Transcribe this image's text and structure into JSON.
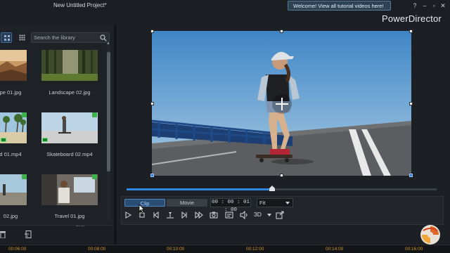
{
  "window": {
    "project_title": "New Untitled Project*",
    "welcome_banner": "Welcome! View all tutorial videos here!",
    "help_label": "?",
    "brand": "PowerDirector",
    "accent_color": "#2f86e0"
  },
  "library": {
    "search_placeholder": "Search the library",
    "items": [
      {
        "label": "pe 01.jpg",
        "icon": "landscape-thumbnail"
      },
      {
        "label": "Landscape 02.jpg",
        "icon": "forest-thumbnail"
      },
      {
        "label": "d 01.mp4",
        "icon": "beach-video-thumbnail",
        "used": true
      },
      {
        "label": "Skateboard 02.mp4",
        "icon": "skateboard-video-thumbnail",
        "used": true
      },
      {
        "label": "02.jpg",
        "icon": "travel-thumbnail",
        "used": true
      },
      {
        "label": "Travel 01.jpg",
        "icon": "travel-photo-thumbnail",
        "used": true
      }
    ]
  },
  "preview": {
    "tabs": [
      "Clip",
      "Movie"
    ],
    "active_tab": "Clip",
    "timecode": "00 : 00 : 01 : 00",
    "zoom": "Fit",
    "seek_progress": 0.47,
    "mode_3d": "3D"
  },
  "timeline": {
    "ticks": [
      "00:06:00",
      "00:08:00",
      "00:10:00",
      "00:12:00",
      "00:14:00",
      "00:16:00"
    ]
  }
}
